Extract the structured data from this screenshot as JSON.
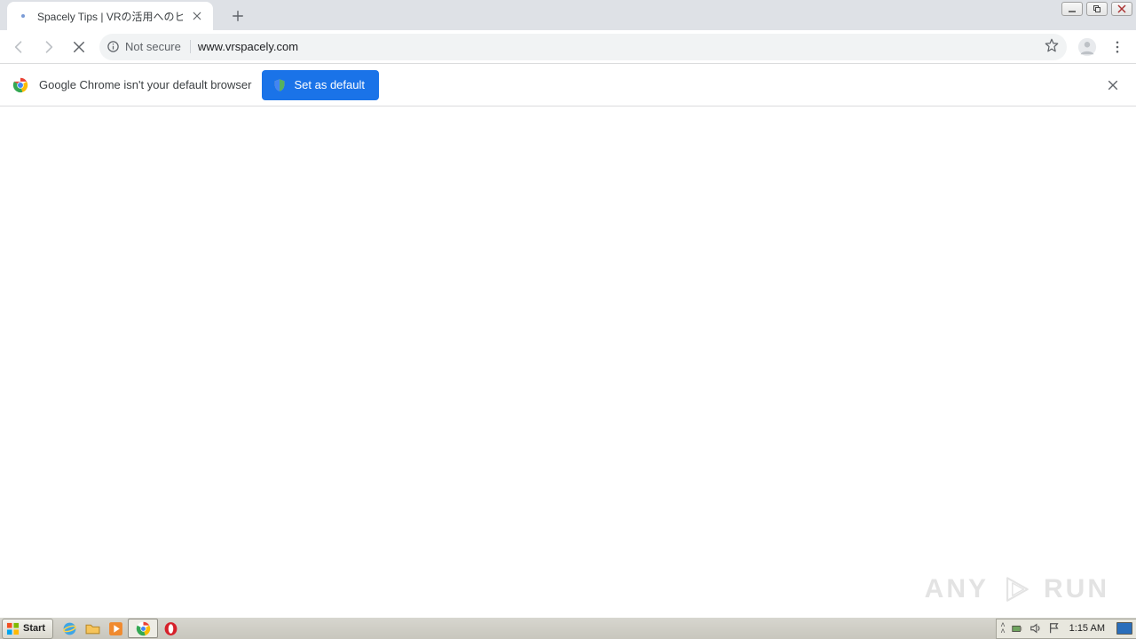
{
  "tab": {
    "title": "Spacely Tips | VRの活用へのヒントが見"
  },
  "nav": {
    "security_label": "Not secure",
    "url": "www.vrspacely.com"
  },
  "infobar": {
    "message": "Google Chrome isn't your default browser",
    "button": "Set as default"
  },
  "watermark": {
    "left": "ANY",
    "right": "RUN"
  },
  "taskbar": {
    "start": "Start",
    "clock": "1:15 AM"
  }
}
